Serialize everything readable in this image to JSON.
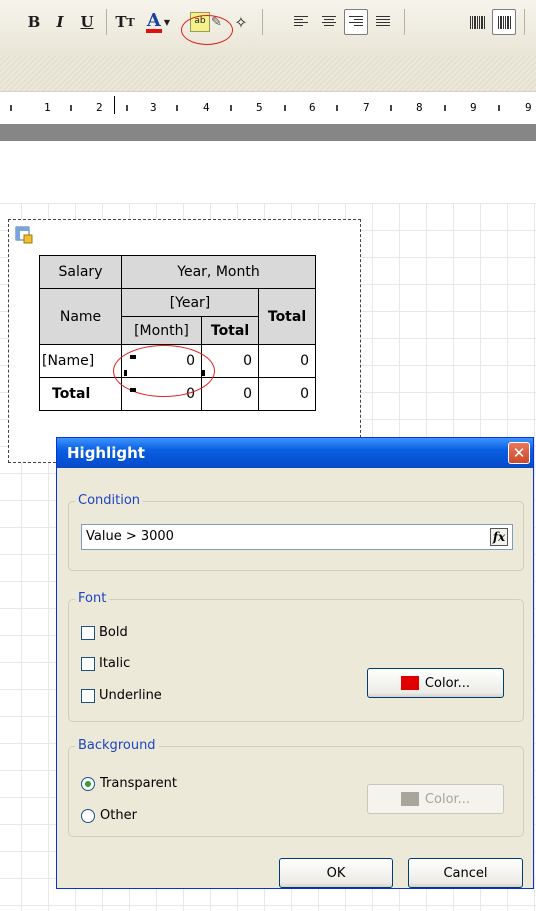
{
  "toolbar": {
    "bold": "B",
    "italic": "I",
    "underline": "U",
    "text_rotation": "T",
    "font_color": "A",
    "highlight_icon_text": "ab",
    "colors": {
      "font_color_bar": "#e01010"
    }
  },
  "ruler": {
    "marks": [
      "1",
      "2",
      "3",
      "4",
      "5",
      "6",
      "7",
      "8",
      "9"
    ]
  },
  "crosstab": {
    "corner": "Salary",
    "col_header": "Year, Month",
    "row_header": "Name",
    "year": "[Year]",
    "month": "[Month]",
    "total": "Total",
    "total_col": "Total",
    "name_cell": "[Name]",
    "row_total_label": "Total",
    "values_row1": [
      "0",
      "0",
      "0"
    ],
    "values_row2": [
      "0",
      "0",
      "0"
    ]
  },
  "dialog": {
    "title": "Highlight",
    "condition": {
      "legend": "Condition",
      "value": "Value > 3000",
      "fx_label": "fx"
    },
    "font": {
      "legend": "Font",
      "bold_label": "Bold",
      "italic_label": "Italic",
      "underline_label": "Underline",
      "color_button": "Color...",
      "color_swatch": "#e00000"
    },
    "background": {
      "legend": "Background",
      "transparent_label": "Transparent",
      "other_label": "Other",
      "color_button": "Color...",
      "color_swatch": "#a8a59a"
    },
    "ok": "OK",
    "cancel": "Cancel"
  }
}
